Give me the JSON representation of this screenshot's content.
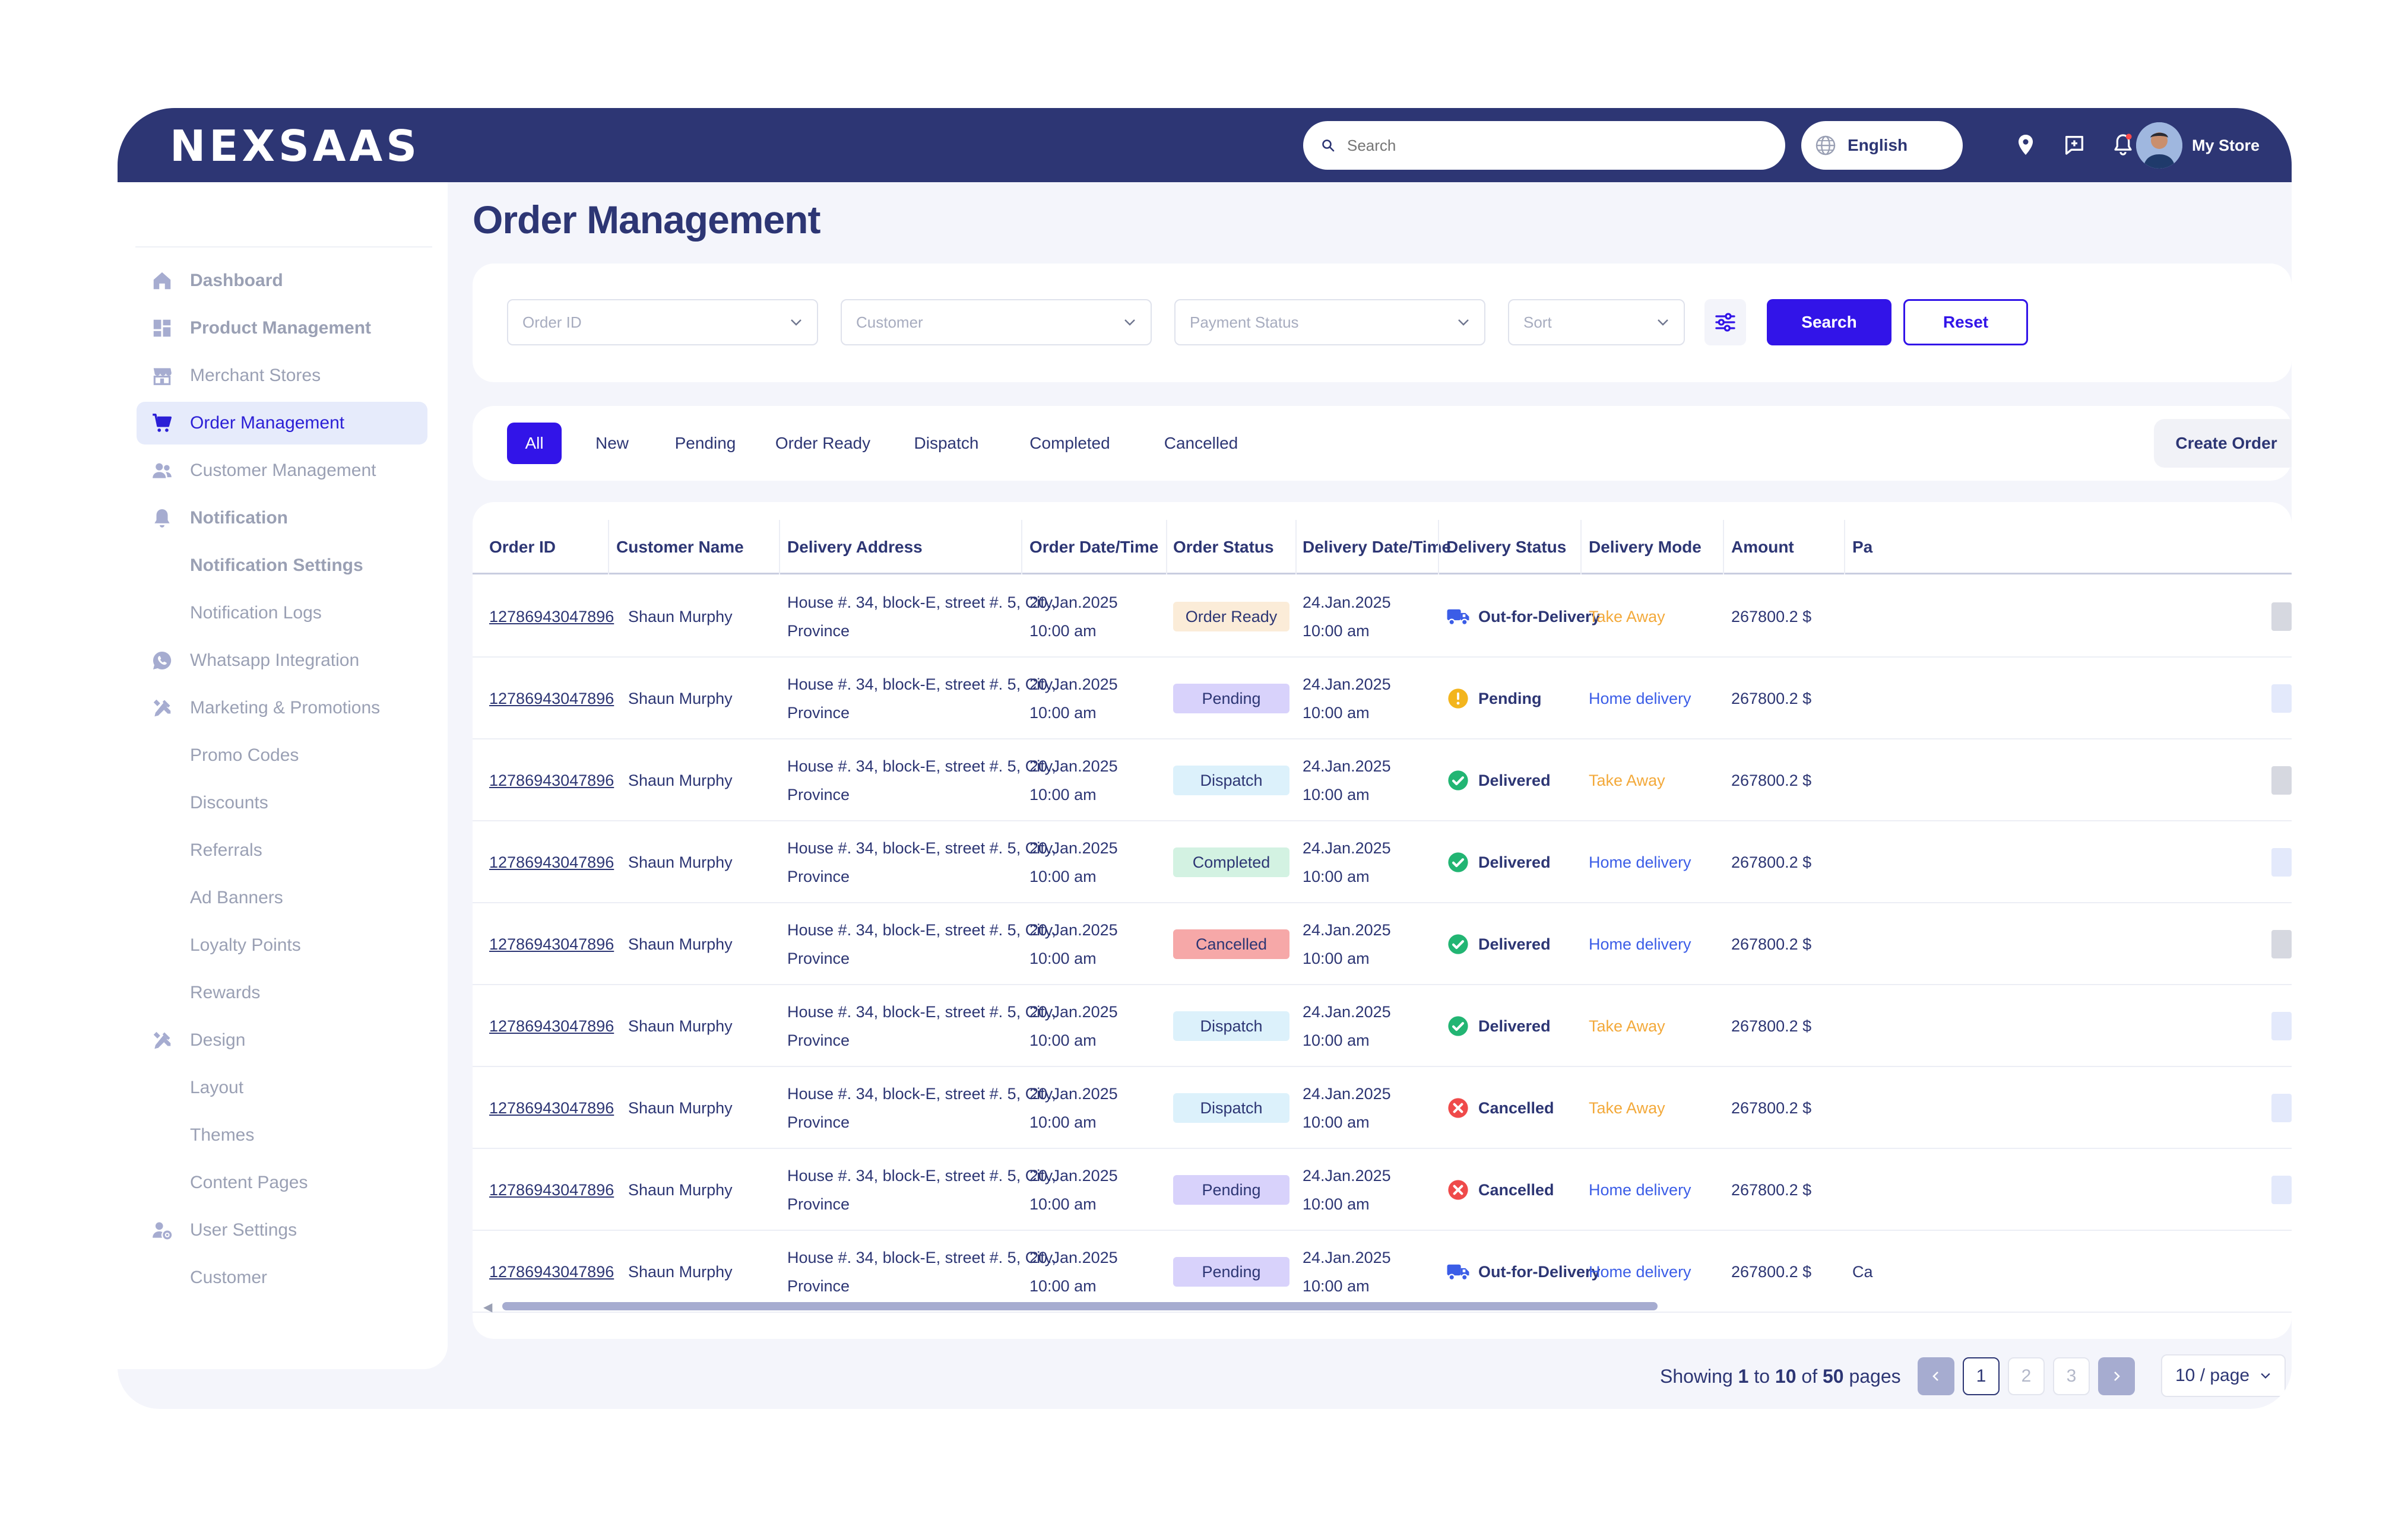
{
  "brand": {
    "logo": "NEXSAAS"
  },
  "topbar": {
    "search_placeholder": "Search",
    "language": "English",
    "store_name": "My Store"
  },
  "sidebar": {
    "items": [
      {
        "label": "Dashboard",
        "icon": "home-icon",
        "bold": true
      },
      {
        "label": "Product Management",
        "icon": "grid-icon",
        "bold": true
      },
      {
        "label": "Merchant Stores",
        "icon": "store-icon",
        "bold": false
      },
      {
        "label": "Order Management",
        "icon": "cart-icon",
        "bold": false,
        "active": true
      },
      {
        "label": "Customer Management",
        "icon": "users-icon",
        "bold": false
      },
      {
        "label": "Notification",
        "icon": "bell-icon",
        "bold": true
      },
      {
        "label": "Notification Settings",
        "bold": true,
        "sub": true
      },
      {
        "label": "Notification Logs",
        "sub": true
      },
      {
        "label": "Whatsapp Integration",
        "icon": "whatsapp-icon"
      },
      {
        "label": "Marketing & Promotions",
        "icon": "tools-icon"
      },
      {
        "label": "Promo Codes",
        "sub": true
      },
      {
        "label": "Discounts",
        "sub": true
      },
      {
        "label": "Referrals",
        "sub": true
      },
      {
        "label": "Ad Banners",
        "sub": true
      },
      {
        "label": "Loyalty Points",
        "sub": true
      },
      {
        "label": "Rewards",
        "sub": true
      },
      {
        "label": "Design",
        "icon": "tools-icon"
      },
      {
        "label": "Layout",
        "sub": true
      },
      {
        "label": "Themes",
        "sub": true
      },
      {
        "label": "Content Pages",
        "sub": true
      },
      {
        "label": "User Settings",
        "icon": "user-settings-icon"
      },
      {
        "label": "Customer",
        "sub": true
      }
    ]
  },
  "page": {
    "title": "Order Management"
  },
  "filters": {
    "order_id": "Order ID",
    "customer": "Customer",
    "payment_status": "Payment Status",
    "sort": "Sort",
    "search_label": "Search",
    "reset_label": "Reset"
  },
  "tabs": {
    "items": [
      "All",
      "New",
      "Pending",
      "Order Ready",
      "Dispatch",
      "Completed",
      "Cancelled"
    ],
    "active": "All",
    "create_label": "Create Order"
  },
  "table": {
    "columns": [
      "Order ID",
      "Customer Name",
      "Delivery Address",
      "Order Date/Time",
      "Order Status",
      "Delivery Date/Time",
      "Delivery Status",
      "Delivery Mode",
      "Amount",
      "Pa"
    ],
    "rows": [
      {
        "id": "12786943047896",
        "customer": "Shaun Murphy",
        "addr1": "House #. 34, block-E, street #. 5, City,",
        "addr2": "Province",
        "odate": "20.Jan.2025",
        "otime": "10:00 am",
        "status": "Order Ready",
        "ddate": "24.Jan.2025",
        "dtime": "10:00 am",
        "dstatus": "Out-for-Delivery",
        "mode": "Take Away",
        "amount": "267800.2 $",
        "pay": ""
      },
      {
        "id": "12786943047896",
        "customer": "Shaun Murphy",
        "addr1": "House #. 34, block-E, street #. 5, City,",
        "addr2": "Province",
        "odate": "20.Jan.2025",
        "otime": "10:00 am",
        "status": "Pending",
        "ddate": "24.Jan.2025",
        "dtime": "10:00 am",
        "dstatus": "Pending",
        "mode": "Home delivery",
        "amount": "267800.2 $",
        "pay": ""
      },
      {
        "id": "12786943047896",
        "customer": "Shaun Murphy",
        "addr1": "House #. 34, block-E, street #. 5, City,",
        "addr2": "Province",
        "odate": "20.Jan.2025",
        "otime": "10:00 am",
        "status": "Dispatch",
        "ddate": "24.Jan.2025",
        "dtime": "10:00 am",
        "dstatus": "Delivered",
        "mode": "Take Away",
        "amount": "267800.2 $",
        "pay": ""
      },
      {
        "id": "12786943047896",
        "customer": "Shaun Murphy",
        "addr1": "House #. 34, block-E, street #. 5, City,",
        "addr2": "Province",
        "odate": "20.Jan.2025",
        "otime": "10:00 am",
        "status": "Completed",
        "ddate": "24.Jan.2025",
        "dtime": "10:00 am",
        "dstatus": "Delivered",
        "mode": "Home delivery",
        "amount": "267800.2 $",
        "pay": ""
      },
      {
        "id": "12786943047896",
        "customer": "Shaun Murphy",
        "addr1": "House #. 34, block-E, street #. 5, City,",
        "addr2": "Province",
        "odate": "20.Jan.2025",
        "otime": "10:00 am",
        "status": "Cancelled",
        "ddate": "24.Jan.2025",
        "dtime": "10:00 am",
        "dstatus": "Delivered",
        "mode": "Home delivery",
        "amount": "267800.2 $",
        "pay": ""
      },
      {
        "id": "12786943047896",
        "customer": "Shaun Murphy",
        "addr1": "House #. 34, block-E, street #. 5, City,",
        "addr2": "Province",
        "odate": "20.Jan.2025",
        "otime": "10:00 am",
        "status": "Dispatch",
        "ddate": "24.Jan.2025",
        "dtime": "10:00 am",
        "dstatus": "Delivered",
        "mode": "Take Away",
        "amount": "267800.2 $",
        "pay": ""
      },
      {
        "id": "12786943047896",
        "customer": "Shaun Murphy",
        "addr1": "House #. 34, block-E, street #. 5, City,",
        "addr2": "Province",
        "odate": "20.Jan.2025",
        "otime": "10:00 am",
        "status": "Dispatch",
        "ddate": "24.Jan.2025",
        "dtime": "10:00 am",
        "dstatus": "Cancelled",
        "mode": "Take Away",
        "amount": "267800.2 $",
        "pay": ""
      },
      {
        "id": "12786943047896",
        "customer": "Shaun Murphy",
        "addr1": "House #. 34, block-E, street #. 5, City,",
        "addr2": "Province",
        "odate": "20.Jan.2025",
        "otime": "10:00 am",
        "status": "Pending",
        "ddate": "24.Jan.2025",
        "dtime": "10:00 am",
        "dstatus": "Cancelled",
        "mode": "Home delivery",
        "amount": "267800.2 $",
        "pay": ""
      },
      {
        "id": "12786943047896",
        "customer": "Shaun Murphy",
        "addr1": "House #. 34, block-E, street #. 5, City,",
        "addr2": "Province",
        "odate": "20.Jan.2025",
        "otime": "10:00 am",
        "status": "Pending",
        "ddate": "24.Jan.2025",
        "dtime": "10:00 am",
        "dstatus": "Out-for-Delivery",
        "mode": "Home delivery",
        "amount": "267800.2 $",
        "pay": "Ca"
      }
    ]
  },
  "status_colors": {
    "Order Ready": {
      "bg": "#fbecd8",
      "fg": "#2d3674"
    },
    "Pending": {
      "bg": "#d8d2fb",
      "fg": "#2d3674"
    },
    "Dispatch": {
      "bg": "#dcf1fb",
      "fg": "#2d3674"
    },
    "Completed": {
      "bg": "#d3f2e2",
      "fg": "#2d3674"
    },
    "Cancelled": {
      "bg": "#f6a8a8",
      "fg": "#2d3674"
    }
  },
  "delivery_icons": {
    "Out-for-Delivery": "truck-icon",
    "Pending": "warning-icon",
    "Delivered": "check-circle-icon",
    "Cancelled": "x-circle-icon"
  },
  "pagination": {
    "showing_prefix": "Showing ",
    "from": "1",
    "to_word": " to ",
    "to": "10",
    "of_word": " of ",
    "total": "50",
    "suffix": " pages",
    "pages": [
      "1",
      "2",
      "3"
    ],
    "current": "1",
    "page_size": "10 / page"
  },
  "colors": {
    "navy": "#2d3674",
    "accent": "#3214e8",
    "take_away": "#f3a93a",
    "home_delivery": "#3b5de7"
  }
}
